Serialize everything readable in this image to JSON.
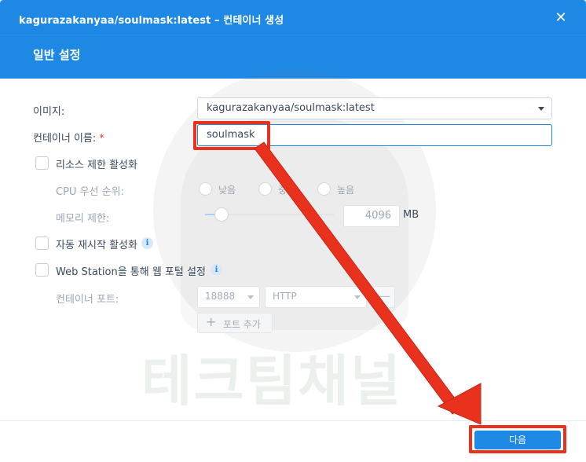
{
  "window": {
    "title": "kagurazakanyaa/soulmask:latest – 컨테이너 생성",
    "close_glyph": "✕",
    "section_title": "일반 설정"
  },
  "form": {
    "image_label": "이미지:",
    "image_value": "kagurazakanyaa/soulmask:latest",
    "container_name_label": "컨테이너 이름:",
    "required_mark": "*",
    "container_name_value": "soulmask",
    "resource_limit_label": "리소스 제한 활성화",
    "cpu_priority_label": "CPU 우선 순위:",
    "cpu_options": [
      "낮음",
      "중간",
      "높음"
    ],
    "memory_limit_label": "메모리 제한:",
    "memory_value": "4096",
    "memory_unit": "MB",
    "memory_slider_level": 0.12,
    "auto_restart_label": "자동 재시작 활성화",
    "web_station_label": "Web Station을 통해 웹 포털 설정",
    "container_port_label": "컨테이너 포트:",
    "port_value": "18888",
    "protocol_value": "HTTP",
    "add_port_label": "포트 추가",
    "info_glyph": "i",
    "minus_glyph": "—",
    "plus_glyph": "+"
  },
  "footer": {
    "next_label": "다음"
  },
  "watermark": {
    "text": "테크팀채널"
  },
  "colors": {
    "header_blue": "#1e88e5",
    "highlight_red": "#e8321e"
  },
  "icons": {
    "close": "close-icon",
    "caret": "chevron-down-icon",
    "info": "info-icon",
    "plus": "plus-icon",
    "minus": "minus-icon",
    "annotation_arrow": "arrow-icon"
  }
}
